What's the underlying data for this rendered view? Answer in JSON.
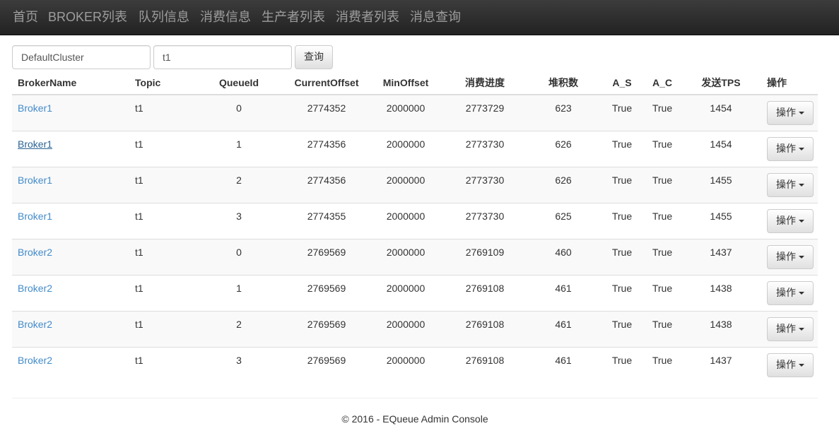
{
  "nav": {
    "items": [
      {
        "label": "首页",
        "name": "nav-home"
      },
      {
        "label": "BROKER列表",
        "name": "nav-broker-list"
      },
      {
        "label": "队列信息",
        "name": "nav-queue-info"
      },
      {
        "label": "消费信息",
        "name": "nav-consume-info"
      },
      {
        "label": "生产者列表",
        "name": "nav-producer-list"
      },
      {
        "label": "消费者列表",
        "name": "nav-consumer-list"
      },
      {
        "label": "消息查询",
        "name": "nav-message-query"
      }
    ]
  },
  "search": {
    "cluster_value": "DefaultCluster",
    "topic_value": "t1",
    "query_label": "查询"
  },
  "table": {
    "headers": [
      "BrokerName",
      "Topic",
      "QueueId",
      "CurrentOffset",
      "MinOffset",
      "消费进度",
      "堆积数",
      "A_S",
      "A_C",
      "发送TPS",
      "操作"
    ],
    "rows": [
      [
        "Broker1",
        "t1",
        "0",
        "2774352",
        "2000000",
        "2773729",
        "623",
        "True",
        "True",
        "1454",
        "操作"
      ],
      [
        "Broker1",
        "t1",
        "1",
        "2774356",
        "2000000",
        "2773730",
        "626",
        "True",
        "True",
        "1454",
        "操作"
      ],
      [
        "Broker1",
        "t1",
        "2",
        "2774356",
        "2000000",
        "2773730",
        "626",
        "True",
        "True",
        "1455",
        "操作"
      ],
      [
        "Broker1",
        "t1",
        "3",
        "2774355",
        "2000000",
        "2773730",
        "625",
        "True",
        "True",
        "1455",
        "操作"
      ],
      [
        "Broker2",
        "t1",
        "0",
        "2769569",
        "2000000",
        "2769109",
        "460",
        "True",
        "True",
        "1437",
        "操作"
      ],
      [
        "Broker2",
        "t1",
        "1",
        "2769569",
        "2000000",
        "2769108",
        "461",
        "True",
        "True",
        "1438",
        "操作"
      ],
      [
        "Broker2",
        "t1",
        "2",
        "2769569",
        "2000000",
        "2769108",
        "461",
        "True",
        "True",
        "1438",
        "操作"
      ],
      [
        "Broker2",
        "t1",
        "3",
        "2769569",
        "2000000",
        "2769108",
        "461",
        "True",
        "True",
        "1437",
        "操作"
      ]
    ]
  },
  "footer": {
    "text": "© 2016 - EQueue Admin Console"
  },
  "colors": {
    "link": "#428bca",
    "navbar": "#222222",
    "nav_text": "#9d9d9d"
  }
}
